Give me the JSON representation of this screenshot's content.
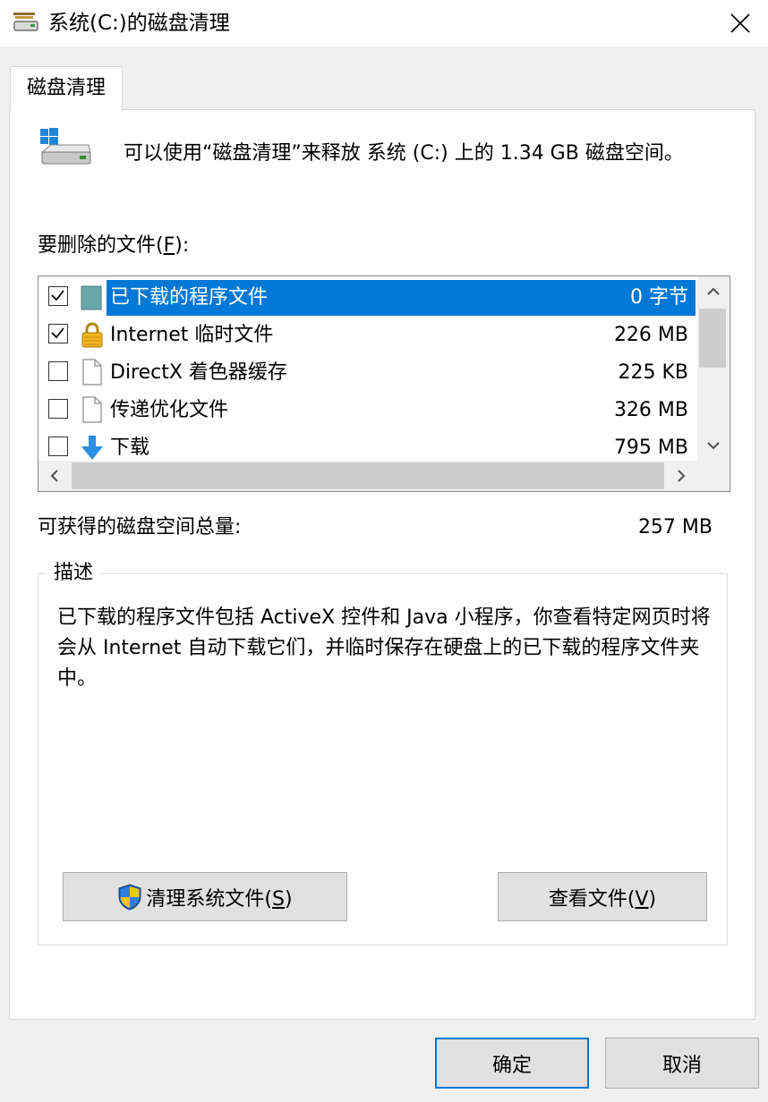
{
  "window": {
    "title": "系统(C:)的磁盘清理",
    "close_icon": "close-icon"
  },
  "tab": {
    "label": "磁盘清理"
  },
  "header": {
    "info": "可以使用“磁盘清理”来释放 系统 (C:) 上的 1.34 GB 磁盘空间。"
  },
  "files": {
    "label_prefix": "要删除的文件(",
    "label_key": "F",
    "label_suffix": "):",
    "items": [
      {
        "name": "已下载的程序文件",
        "size": "0 字节",
        "checked": true,
        "selected": true,
        "icon": "folder-icon"
      },
      {
        "name": "Internet 临时文件",
        "size": "226 MB",
        "checked": true,
        "selected": false,
        "icon": "lock-icon"
      },
      {
        "name": "DirectX 着色器缓存",
        "size": "225 KB",
        "checked": false,
        "selected": false,
        "icon": "file-icon"
      },
      {
        "name": "传递优化文件",
        "size": "326 MB",
        "checked": false,
        "selected": false,
        "icon": "file-icon"
      },
      {
        "name": "下载",
        "size": "795 MB",
        "checked": false,
        "selected": false,
        "icon": "download-arrow-icon"
      }
    ]
  },
  "total": {
    "label": "可获得的磁盘空间总量:",
    "value": "257 MB"
  },
  "description": {
    "title": "描述",
    "text": "已下载的程序文件包括 ActiveX 控件和 Java 小程序，你查看特定网页时将会从 Internet 自动下载它们，并临时保存在硬盘上的已下载的程序文件夹中。"
  },
  "buttons": {
    "clean_prefix": "清理系统文件(",
    "clean_key": "S",
    "clean_suffix": ")",
    "view_prefix": "查看文件(",
    "view_key": "V",
    "view_suffix": ")",
    "ok": "确定",
    "cancel": "取消"
  },
  "colors": {
    "selection": "#0078d7",
    "background": "#f0f0f0"
  }
}
